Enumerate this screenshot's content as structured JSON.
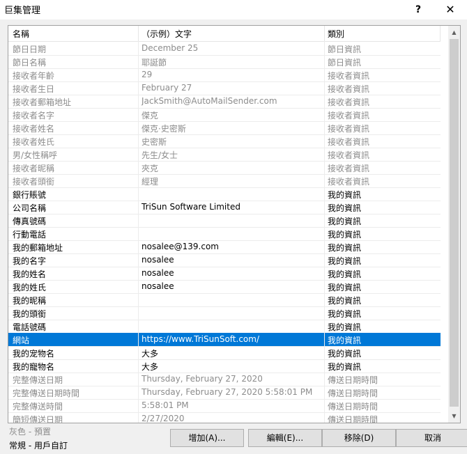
{
  "window": {
    "title": "巨集管理",
    "help": "?",
    "close": "✕"
  },
  "columns": [
    "名稱",
    "（示例）文字",
    "類別"
  ],
  "rows": [
    {
      "name": "節日日期",
      "example": "December 25",
      "category": "節日資訊",
      "gray": true
    },
    {
      "name": "節日名稱",
      "example": "耶誕節",
      "category": "節日資訊",
      "gray": true
    },
    {
      "name": "接收者年齡",
      "example": "29",
      "category": "接收者資訊",
      "gray": true
    },
    {
      "name": "接收者生日",
      "example": "February 27",
      "category": "接收者資訊",
      "gray": true
    },
    {
      "name": "接收者郵箱地址",
      "example": "JackSmith@AutoMailSender.com",
      "category": "接收者資訊",
      "gray": true
    },
    {
      "name": "接收者名字",
      "example": "傑克",
      "category": "接收者資訊",
      "gray": true
    },
    {
      "name": "接收者姓名",
      "example": "傑克·史密斯",
      "category": "接收者資訊",
      "gray": true
    },
    {
      "name": "接收者姓氏",
      "example": "史密斯",
      "category": "接收者資訊",
      "gray": true
    },
    {
      "name": "男/女性稱呼",
      "example": "先生/女士",
      "category": "接收者資訊",
      "gray": true
    },
    {
      "name": "接收者昵稱",
      "example": "夾克",
      "category": "接收者資訊",
      "gray": true
    },
    {
      "name": "接收者頭銜",
      "example": "經理",
      "category": "接收者資訊",
      "gray": true
    },
    {
      "name": "銀行賬號",
      "example": "",
      "category": "我的資訊",
      "gray": false
    },
    {
      "name": "公司名稱",
      "example": "TriSun Software Limited",
      "category": "我的資訊",
      "gray": false
    },
    {
      "name": "傳真號碼",
      "example": "",
      "category": "我的資訊",
      "gray": false
    },
    {
      "name": "行動電話",
      "example": "",
      "category": "我的資訊",
      "gray": false
    },
    {
      "name": "我的郵箱地址",
      "example": "nosalee@139.com",
      "category": "我的資訊",
      "gray": false
    },
    {
      "name": "我的名字",
      "example": "nosalee",
      "category": "我的資訊",
      "gray": false
    },
    {
      "name": "我的姓名",
      "example": "nosalee",
      "category": "我的資訊",
      "gray": false
    },
    {
      "name": "我的姓氏",
      "example": "nosalee",
      "category": "我的資訊",
      "gray": false
    },
    {
      "name": "我的昵稱",
      "example": "",
      "category": "我的資訊",
      "gray": false
    },
    {
      "name": "我的頭銜",
      "example": "",
      "category": "我的資訊",
      "gray": false
    },
    {
      "name": "電話號碼",
      "example": "",
      "category": "我的資訊",
      "gray": false
    },
    {
      "name": "網站",
      "example": "https://www.TriSunSoft.com/",
      "category": "我的資訊",
      "gray": false,
      "selected": true
    },
    {
      "name": "我的宠物名",
      "example": "大多",
      "category": "我的資訊",
      "gray": false
    },
    {
      "name": "我的寵物名",
      "example": "大多",
      "category": "我的資訊",
      "gray": false
    },
    {
      "name": "完整傳送日期",
      "example": "Thursday, February 27, 2020",
      "category": "傳送日期時間",
      "gray": true
    },
    {
      "name": "完整傳送日期時間",
      "example": "Thursday, February 27, 2020 5:58:01 PM",
      "category": "傳送日期時間",
      "gray": true
    },
    {
      "name": "完整傳送時間",
      "example": "5:58:01 PM",
      "category": "傳送日期時間",
      "gray": true
    },
    {
      "name": "簡短傳送日期",
      "example": "2/27/2020",
      "category": "傳送日期時間",
      "gray": true
    }
  ],
  "scroll": {
    "up": "▲",
    "down": "▼"
  },
  "legend": {
    "gray": "灰色 - 預置",
    "normal": "常規 - 用戶自訂"
  },
  "buttons": {
    "add": "增加(A)...",
    "edit": "編輯(E)...",
    "remove": "移除(D)",
    "cancel": "取消"
  }
}
